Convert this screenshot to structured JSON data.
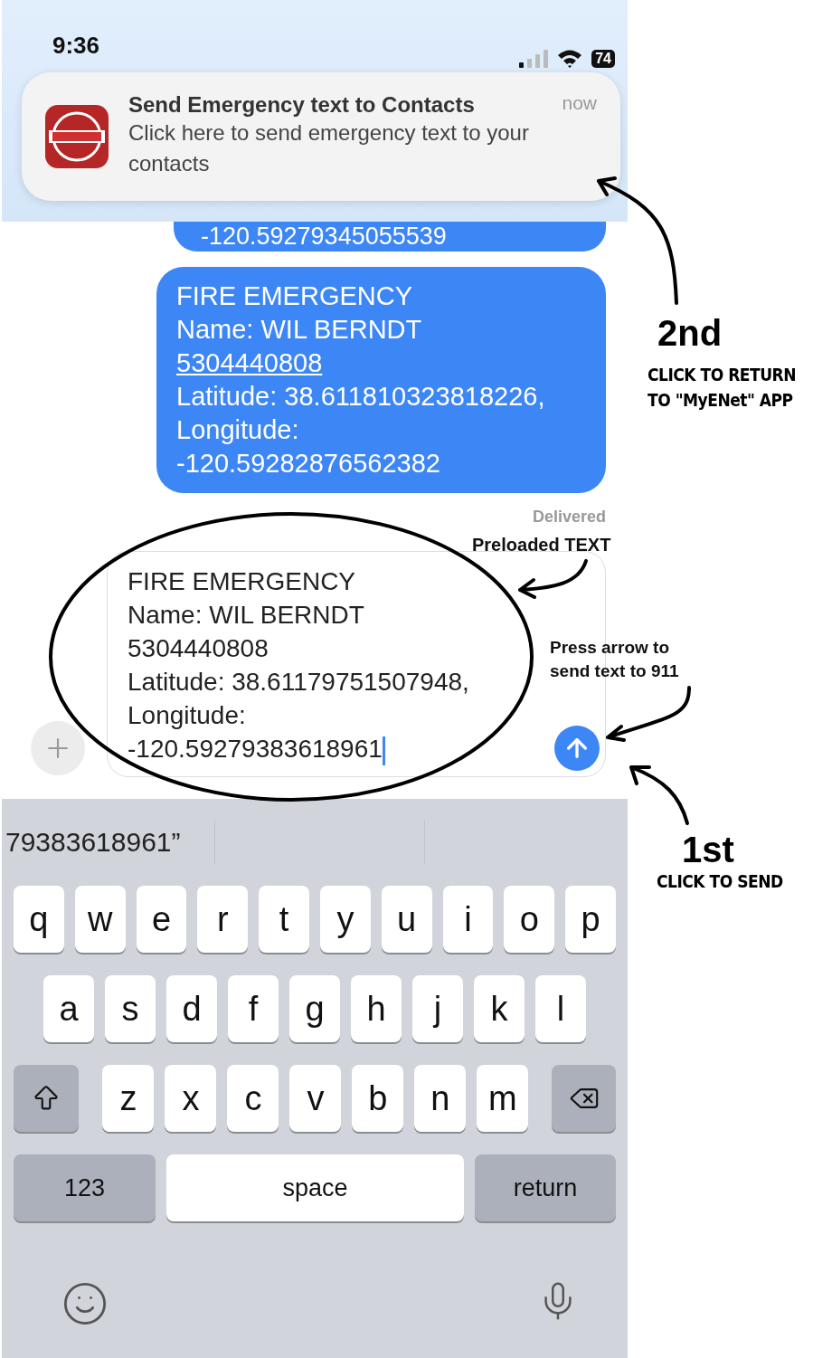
{
  "status_bar": {
    "time": "9:36",
    "battery": "74"
  },
  "notification": {
    "title": "Send Emergency text to Contacts",
    "time": "now",
    "body": "Click here to send emergency text to your contacts"
  },
  "messages": [
    {
      "lines": [
        {
          "kind": "text",
          "text": "-120.59279345055539"
        }
      ]
    },
    {
      "lines": [
        {
          "kind": "text",
          "text": "FIRE EMERGENCY"
        },
        {
          "kind": "text",
          "text": "Name: WIL BERNDT"
        },
        {
          "kind": "link",
          "text": "5304440808"
        },
        {
          "kind": "text",
          "text": "Latitude: 38.611810323818226,"
        },
        {
          "kind": "text",
          "text": "Longitude:"
        },
        {
          "kind": "text",
          "text": "-120.59282876562382"
        }
      ]
    }
  ],
  "delivery_status": "Delivered",
  "compose": {
    "lines": [
      "FIRE EMERGENCY",
      "Name: WIL BERNDT",
      "5304440808",
      "Latitude: 38.61179751507948,",
      "Longitude:",
      "-120.59279383618961"
    ]
  },
  "keyboard": {
    "suggestions": [
      "79383618961”"
    ],
    "rows": [
      [
        "q",
        "w",
        "e",
        "r",
        "t",
        "y",
        "u",
        "i",
        "o",
        "p"
      ],
      [
        "a",
        "s",
        "d",
        "f",
        "g",
        "h",
        "j",
        "k",
        "l"
      ],
      [
        "z",
        "x",
        "c",
        "v",
        "b",
        "n",
        "m"
      ]
    ],
    "numbers_key": "123",
    "space_key": "space",
    "return_key": "return"
  },
  "annotations": {
    "preloaded": "Preloaded TEXT",
    "press_arrow": "Press arrow to\nsend text to 911",
    "steps": [
      {
        "kind": "return",
        "step": "2nd",
        "caption": "CLICK TO RETURN\nTO \"MyENet\" APP"
      },
      {
        "kind": "send",
        "step": "1st",
        "caption": "CLICK TO SEND"
      }
    ]
  }
}
